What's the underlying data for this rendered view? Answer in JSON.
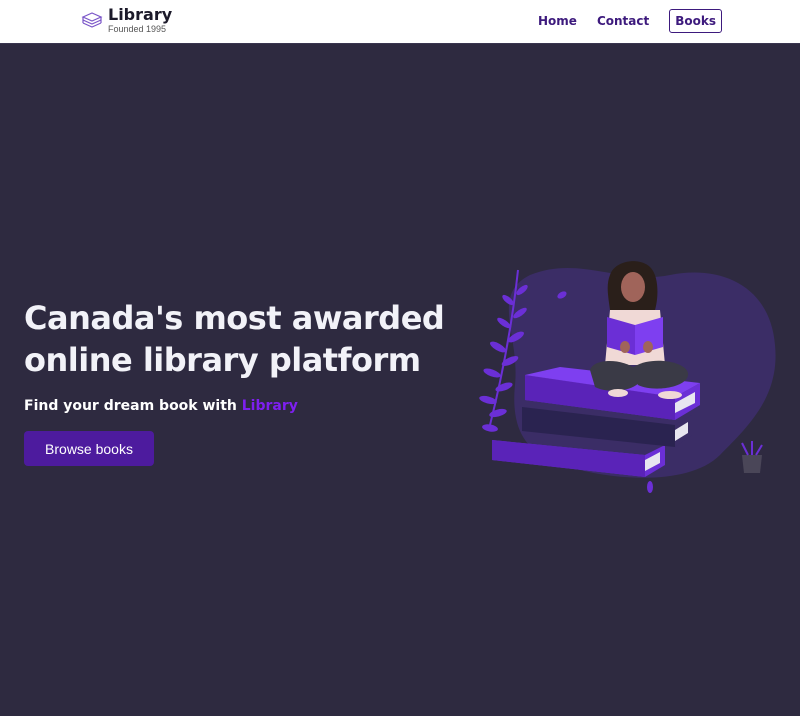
{
  "nav": {
    "brand_name": "Library",
    "brand_sub": "Founded 1995",
    "links": [
      {
        "label": "Home",
        "active": false
      },
      {
        "label": "Contact",
        "active": false
      },
      {
        "label": "Books",
        "active": true
      }
    ]
  },
  "hero": {
    "title": "Canada's most awarded online library platform",
    "sub_prefix": "Find your dream book with ",
    "sub_brand": "Library",
    "cta_label": "Browse books"
  },
  "colors": {
    "background": "#2e2a40",
    "accent": "#7e1ff0",
    "button": "#4d1b9e",
    "nav_link": "#3d1a7d"
  },
  "icons": {
    "brand": "books-stack-icon",
    "illustration": "reading-woman-on-books-illustration"
  }
}
